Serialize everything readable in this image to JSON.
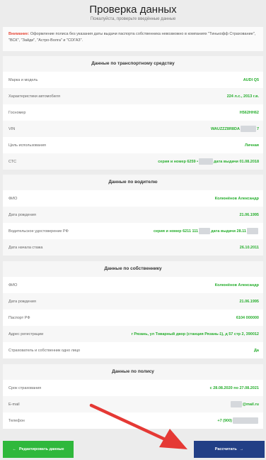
{
  "header": {
    "title": "Проверка данных",
    "subtitle": "Пожалуйста, проверьте введённые данные"
  },
  "warning": {
    "label": "Внимание:",
    "text": " Оформление полиса без указания даты выдачи паспорта собственника невозможно в компаниях \"Тинькофф Страхование\", \"ВСК\", \"Зайди\", \"Астро-Волга\" и \"СОГАЗ\"."
  },
  "vehicle": {
    "title": "Данные по транспортному средству",
    "make_label": "Марка и модель",
    "make_value": "AUDI Q5",
    "specs_label": "Характеристики автомобиля",
    "specs_value": "224 л.с., 2013 г.в.",
    "plate_label": "Госномер",
    "plate_value": "Н562НН62",
    "vin_label": "VIN",
    "vin_prefix": "WAUZZZ8R8DA",
    "vin_suffix": "7",
    "purpose_label": "Цель использования",
    "purpose_value": "Личная",
    "sts_label": "СТС",
    "sts_number_prefix": "серия и номер 6259 •",
    "sts_date": "дата выдачи 01.08.2018"
  },
  "driver": {
    "title": "Данные по водителю",
    "name_label": "ФИО",
    "name_value": "Колюнёнов Александр",
    "birth_label": "Дата рождения",
    "birth_value": "21.06.1995",
    "license_label": "Водительское удостоверение РФ",
    "license_prefix": "серия и номер 6211 111",
    "license_date": "дата выдачи 28.11",
    "exp_label": "Дата начала стажа",
    "exp_value": "26.10.2011"
  },
  "owner": {
    "title": "Данные по собственнику",
    "name_label": "ФИО",
    "name_value": "Колюнёнов Александр",
    "birth_label": "Дата рождения",
    "birth_value": "21.06.1995",
    "passport_label": "Паспорт РФ",
    "passport_value": "6104 000000",
    "address_label": "Адрес регистрации",
    "address_value": "г Рязань, ул Товарный двор (станция Рязань-1), д 57 стр 2, 390012",
    "same_label": "Страхователь и собственник одно лицо",
    "same_value": "Да"
  },
  "policy": {
    "title": "Данные по полису",
    "period_label": "Срок страхования",
    "period_value": "с 28.08.2020 по 27.08.2021",
    "email_label": "E-mail",
    "email_suffix": "@mail.ru",
    "phone_label": "Телефон",
    "phone_prefix": "+7 (900)"
  },
  "buttons": {
    "edit": "Редактировать данные",
    "calc": "Рассчитать"
  },
  "colors": {
    "accent_green": "#27ae2e",
    "button_green": "#2fb83c",
    "button_blue": "#223f86",
    "warning_red": "#e74c3c",
    "arrow_red": "#e53935"
  }
}
